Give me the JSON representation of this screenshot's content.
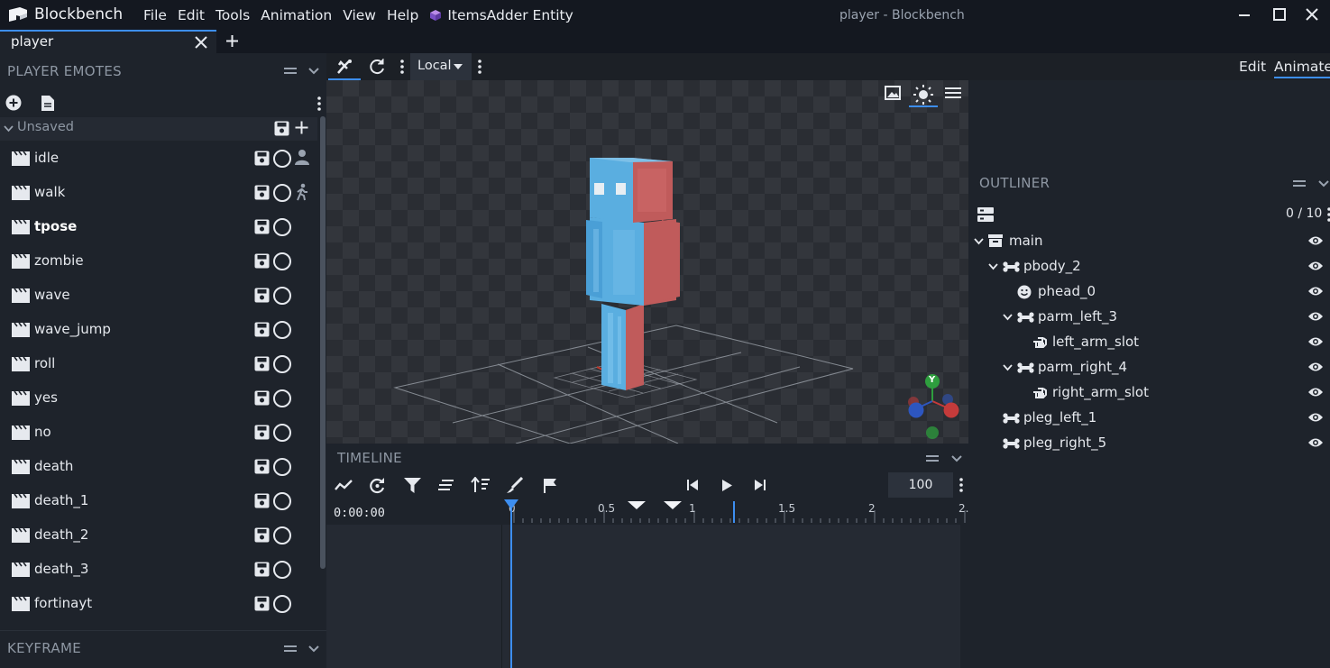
{
  "app": {
    "name": "Blockbench",
    "window_title": "player - Blockbench"
  },
  "menu": {
    "items": [
      "File",
      "Edit",
      "Tools",
      "Animation",
      "View",
      "Help"
    ],
    "plugin": "ItemsAdder Entity"
  },
  "tabs": [
    {
      "label": "player"
    }
  ],
  "toolbar": {
    "space_select": "Local",
    "modes": {
      "edit": "Edit",
      "animate": "Animate"
    }
  },
  "left_panel": {
    "title": "PLAYER EMOTES",
    "group": "Unsaved",
    "animations": [
      {
        "name": "idle",
        "extra": "person-icon"
      },
      {
        "name": "walk",
        "extra": "walk-icon"
      },
      {
        "name": "tpose",
        "extra": ""
      },
      {
        "name": "zombie",
        "extra": ""
      },
      {
        "name": "wave",
        "extra": ""
      },
      {
        "name": "wave_jump",
        "extra": ""
      },
      {
        "name": "roll",
        "extra": ""
      },
      {
        "name": "yes",
        "extra": ""
      },
      {
        "name": "no",
        "extra": ""
      },
      {
        "name": "death",
        "extra": ""
      },
      {
        "name": "death_1",
        "extra": ""
      },
      {
        "name": "death_2",
        "extra": ""
      },
      {
        "name": "death_3",
        "extra": ""
      },
      {
        "name": "fortinayt",
        "extra": ""
      }
    ],
    "selected": "tpose"
  },
  "keyframe_panel": {
    "title": "KEYFRAME"
  },
  "timeline": {
    "title": "TIMELINE",
    "time": "0:00:00",
    "zoom": "100",
    "ticks": [
      "0",
      "0.5",
      "1",
      "1.5",
      "2",
      "2."
    ]
  },
  "outliner": {
    "title": "OUTLINER",
    "count": "0 / 10",
    "items": [
      {
        "name": "main",
        "type": "group",
        "depth": 0,
        "expanded": true
      },
      {
        "name": "pbody_2",
        "type": "bone",
        "depth": 1,
        "expanded": true
      },
      {
        "name": "phead_0",
        "type": "head",
        "depth": 2,
        "expanded": false
      },
      {
        "name": "parm_left_3",
        "type": "bone",
        "depth": 2,
        "expanded": true
      },
      {
        "name": "left_arm_slot",
        "type": "slot",
        "depth": 3,
        "expanded": false
      },
      {
        "name": "parm_right_4",
        "type": "bone",
        "depth": 2,
        "expanded": true
      },
      {
        "name": "right_arm_slot",
        "type": "slot",
        "depth": 3,
        "expanded": false
      },
      {
        "name": "pleg_left_1",
        "type": "bone",
        "depth": 1,
        "expanded": false
      },
      {
        "name": "pleg_right_5",
        "type": "bone",
        "depth": 1,
        "expanded": false
      }
    ]
  },
  "axes": {
    "y": "Y"
  },
  "colors": {
    "accent": "#3d8ef0",
    "model_blue": "#4aa3d8",
    "model_red": "#b45454",
    "axis_green": "#2e9e3e",
    "axis_red": "#c53b3b",
    "axis_blue": "#2d56c0"
  }
}
